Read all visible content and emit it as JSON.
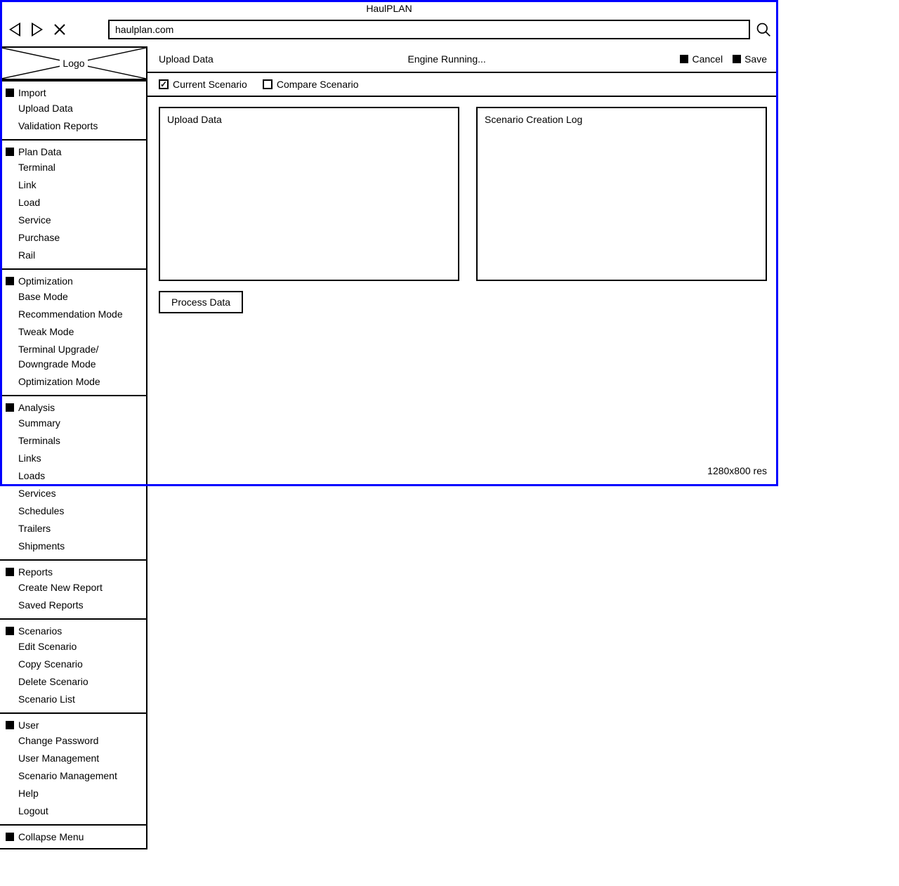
{
  "app_title": "HaulPLAN",
  "url": "haulplan.com",
  "logo_label": "Logo",
  "sidebar": {
    "sections": [
      {
        "title": "Import",
        "items": [
          "Upload Data",
          "Validation Reports"
        ]
      },
      {
        "title": "Plan Data",
        "items": [
          "Terminal",
          "Link",
          "Load",
          "Service",
          "Purchase",
          "Rail"
        ]
      },
      {
        "title": "Optimization",
        "items": [
          "Base Mode",
          "Recommendation Mode",
          "Tweak Mode",
          "Terminal Upgrade/ Downgrade Mode",
          "Optimization Mode"
        ]
      },
      {
        "title": "Analysis",
        "items": [
          "Summary",
          "Terminals",
          "Links",
          "Loads",
          "Services",
          "Schedules",
          "Trailers",
          "Shipments"
        ]
      },
      {
        "title": "Reports",
        "items": [
          "Create New Report",
          "Saved Reports"
        ]
      },
      {
        "title": "Scenarios",
        "items": [
          "Edit Scenario",
          "Copy Scenario",
          "Delete Scenario",
          "Scenario List"
        ]
      },
      {
        "title": "User",
        "items": [
          "Change Password",
          "User Management",
          "Scenario Management",
          "Help",
          "Logout"
        ]
      }
    ],
    "collapse": "Collapse Menu"
  },
  "topbar": {
    "title": "Upload Data",
    "status": "Engine Running...",
    "cancel": "Cancel",
    "save": "Save"
  },
  "tabs": {
    "current": "Current Scenario",
    "compare": "Compare Scenario"
  },
  "panels": {
    "upload": "Upload Data",
    "log": "Scenario Creation Log"
  },
  "process_btn": "Process Data",
  "resolution_note": "1280x800 res"
}
